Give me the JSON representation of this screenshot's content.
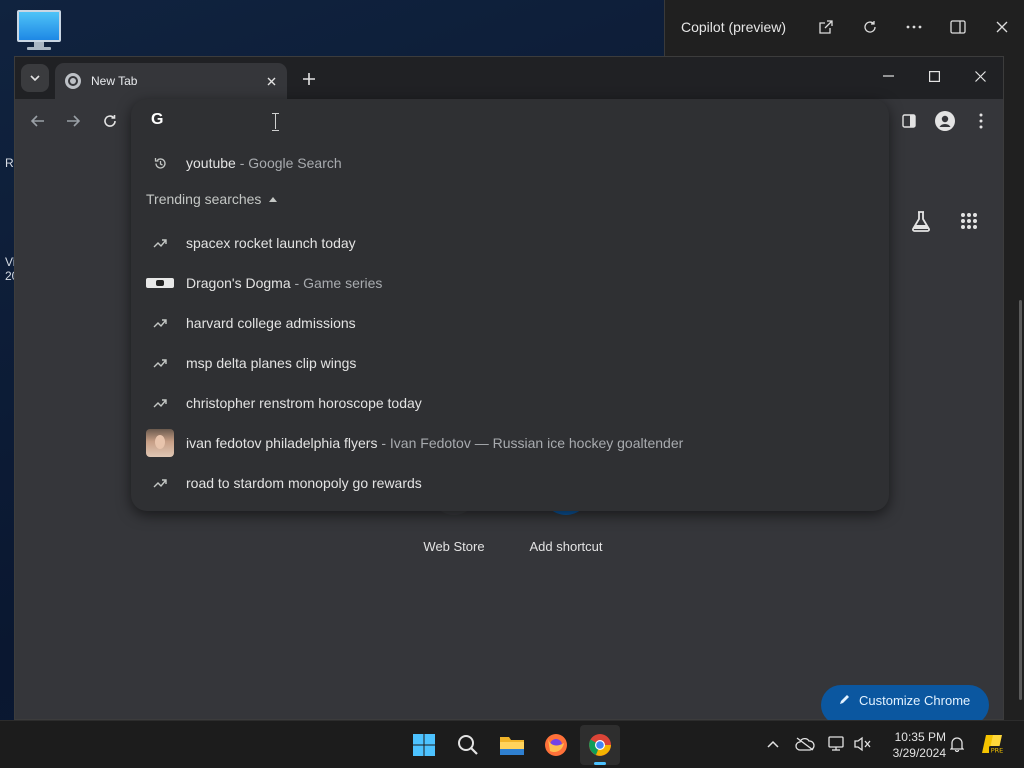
{
  "desktop": {
    "icon": "computer-icon",
    "fragments": [
      "R",
      "Vi",
      "20"
    ]
  },
  "copilot": {
    "title": "Copilot (preview)",
    "icons": [
      "open-external-icon",
      "refresh-icon",
      "more-icon",
      "split-view-icon",
      "close-icon"
    ]
  },
  "chrome": {
    "tab": {
      "title": "New Tab",
      "favicon": "chrome-icon"
    },
    "omnibox": {
      "engine_icon": "google-g-icon",
      "logo_text": "G",
      "value": "",
      "history": [
        {
          "query": "youtube",
          "sub": " - Google Search",
          "icon": "history-icon"
        }
      ],
      "trending_heading": "Trending searches",
      "trending": [
        {
          "query": "spacex rocket launch today",
          "sub": "",
          "icon": "trending-icon"
        },
        {
          "query": "Dragon's Dogma",
          "sub": " - Game series",
          "icon": "dragons-dogma-thumbnail"
        },
        {
          "query": "harvard college admissions",
          "sub": "",
          "icon": "trending-icon"
        },
        {
          "query": "msp delta planes clip wings",
          "sub": "",
          "icon": "trending-icon"
        },
        {
          "query": "christopher renstrom horoscope today",
          "sub": "",
          "icon": "trending-icon"
        },
        {
          "query": "ivan fedotov philadelphia flyers",
          "sub": " - Ivan Fedotov — Russian ice hockey goaltender",
          "icon": "ivan-fedotov-thumbnail"
        },
        {
          "query": "road to stardom monopoly go rewards",
          "sub": "",
          "icon": "trending-icon"
        }
      ]
    },
    "ntp": {
      "shortcuts": [
        {
          "label": "Web Store",
          "icon": "web-store-icon"
        },
        {
          "label": "Add shortcut",
          "icon": "plus-icon"
        }
      ],
      "customize_label": "Customize Chrome"
    }
  },
  "taskbar": {
    "apps": [
      "start-icon",
      "search-icon",
      "file-explorer-icon",
      "firefox-icon",
      "chrome-icon"
    ],
    "clock": {
      "time": "10:35 PM",
      "date": "3/29/2024"
    },
    "copilot_badge": "PRE"
  },
  "colors": {
    "accent": "#4cc2ff",
    "customize": "#0b57a0"
  }
}
